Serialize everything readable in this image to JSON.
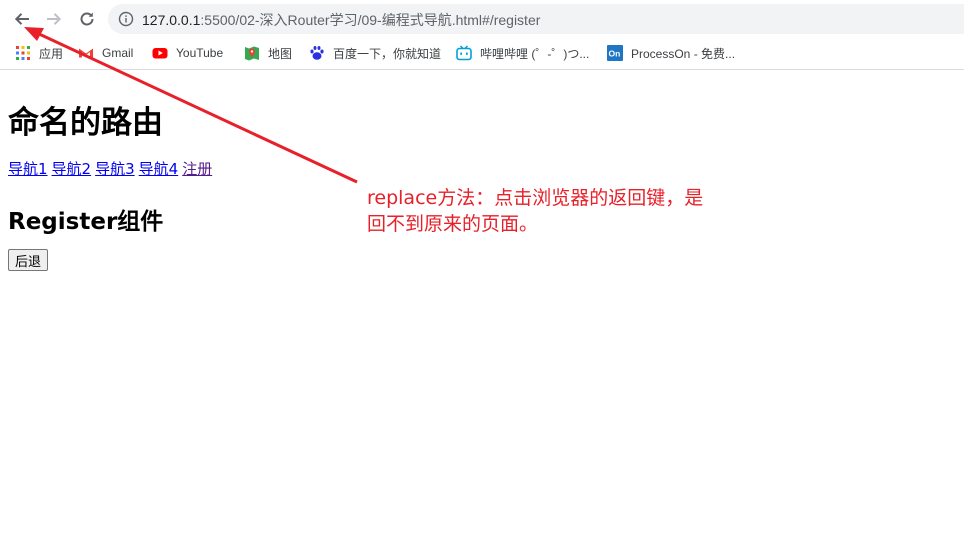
{
  "browser": {
    "url_host": "127.0.0.1",
    "url_rest": ":5500/02-深入Router学习/09-编程式导航.html#/register"
  },
  "bookmarks": [
    {
      "label": "应用",
      "icon": "apps-grid-icon"
    },
    {
      "label": "Gmail",
      "icon": "gmail-icon"
    },
    {
      "label": "YouTube",
      "icon": "youtube-icon"
    },
    {
      "label": "地图",
      "icon": "maps-icon"
    },
    {
      "label": "百度一下，你就知道",
      "icon": "baidu-icon"
    },
    {
      "label": "哔哩哔哩 (゜-゜)つ...",
      "icon": "bilibili-icon"
    },
    {
      "label": "ProcessOn - 免费...",
      "icon": "processon-icon"
    }
  ],
  "page": {
    "title": "命名的路由",
    "nav_links": [
      "导航1",
      "导航2",
      "导航3",
      "导航4",
      "注册"
    ],
    "component_title": "Register组件",
    "back_button_label": "后退"
  },
  "annotation": {
    "text_line1": "replace方法：点击浏览器的返回键，是",
    "text_line2": "回不到原来的页面。",
    "color": "#e8202a"
  }
}
